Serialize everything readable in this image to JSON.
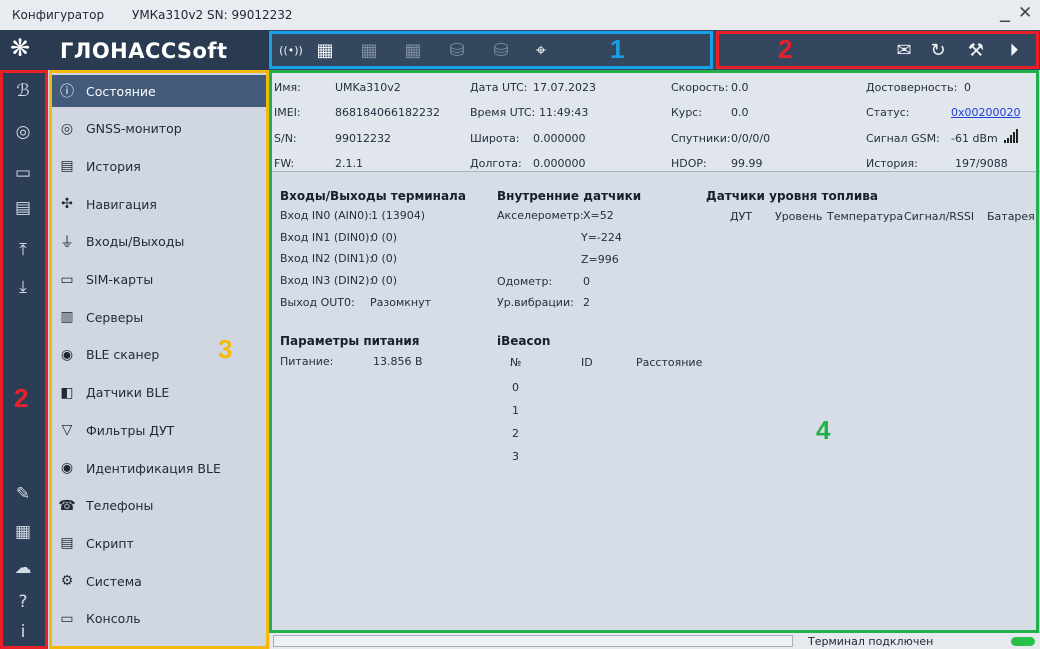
{
  "titlebar": {
    "app": "Конфигуратор",
    "device": "УМКа310v2 SN: 99012232",
    "minimize": "_",
    "close": "✕"
  },
  "logo": {
    "text": "ГЛОНАССSoft",
    "symbol": "❋"
  },
  "toolbar": {
    "icons": [
      {
        "name": "connect-icon",
        "glyph": "((•))",
        "state": "on"
      },
      {
        "name": "terminal-online-icon",
        "glyph": "▦",
        "state": "on"
      },
      {
        "name": "read-config-icon",
        "glyph": "▦",
        "state": "dim"
      },
      {
        "name": "write-config-icon",
        "glyph": "▦",
        "state": "dim"
      },
      {
        "name": "db-settings-icon",
        "glyph": "⛁",
        "state": "dim"
      },
      {
        "name": "db-tools-icon",
        "glyph": "⛁",
        "state": "dim"
      },
      {
        "name": "location-off-icon",
        "glyph": "⌖",
        "state": "on"
      }
    ],
    "right_icons": [
      {
        "name": "send-message-icon",
        "glyph": "✉"
      },
      {
        "name": "reset-icon",
        "glyph": "↻"
      },
      {
        "name": "firmware-update-icon",
        "glyph": "⚒"
      },
      {
        "name": "play-script-icon",
        "glyph": "⏵"
      }
    ]
  },
  "markers": {
    "m1": "1",
    "m2": "2",
    "m2_left": "2",
    "m3": "3",
    "m4": "4"
  },
  "leftbar": {
    "top": [
      {
        "name": "bluetooth-icon",
        "glyph": "ℬ"
      },
      {
        "name": "device-icon",
        "glyph": "◎"
      },
      {
        "name": "open-folder-icon",
        "glyph": "▭"
      },
      {
        "name": "save-icon",
        "glyph": "▤"
      },
      {
        "name": "upload-icon",
        "glyph": "⤒"
      },
      {
        "name": "download-icon",
        "glyph": "⤓"
      }
    ],
    "bottom": [
      {
        "name": "log-icon",
        "glyph": "✎"
      },
      {
        "name": "calculator-icon",
        "glyph": "▦"
      },
      {
        "name": "cloud-icon",
        "glyph": "☁"
      },
      {
        "name": "help-icon",
        "glyph": "?"
      },
      {
        "name": "info-icon",
        "glyph": "i"
      }
    ]
  },
  "menu": [
    {
      "label": "Состояние",
      "icon": "ⓘ",
      "icon_name": "status-icon",
      "active": true
    },
    {
      "label": "GNSS-монитор",
      "icon": "◎",
      "icon_name": "gnss-icon"
    },
    {
      "label": "История",
      "icon": "▤",
      "icon_name": "history-icon"
    },
    {
      "label": "Навигация",
      "icon": "✣",
      "icon_name": "navigation-icon"
    },
    {
      "label": "Входы/Выходы",
      "icon": "⏚",
      "icon_name": "io-icon"
    },
    {
      "label": "SIM-карты",
      "icon": "▭",
      "icon_name": "sim-icon"
    },
    {
      "label": "Серверы",
      "icon": "▥",
      "icon_name": "servers-icon"
    },
    {
      "label": "BLE сканер",
      "icon": "◉",
      "icon_name": "ble-scanner-icon"
    },
    {
      "label": "Датчики BLE",
      "icon": "◧",
      "icon_name": "ble-sensor-icon"
    },
    {
      "label": "Фильтры ДУТ",
      "icon": "▽",
      "icon_name": "fuel-filter-icon"
    },
    {
      "label": "Идентификация BLE",
      "icon": "◉",
      "icon_name": "ble-ident-icon"
    },
    {
      "label": "Телефоны",
      "icon": "☎",
      "icon_name": "phone-icon"
    },
    {
      "label": "Скрипт",
      "icon": "▤",
      "icon_name": "script-icon"
    },
    {
      "label": "Система",
      "icon": "⚙",
      "icon_name": "system-icon"
    },
    {
      "label": "Консоль",
      "icon": "▭",
      "icon_name": "console-icon"
    }
  ],
  "info": {
    "name_l": "Имя:",
    "name_v": "UMKa310v2",
    "imei_l": "IMEI:",
    "imei_v": "868184066182232",
    "sn_l": "S/N:",
    "sn_v": "99012232",
    "fw_l": "FW:",
    "fw_v": "2.1.1",
    "date_l": "Дата UTC:",
    "date_v": "17.07.2023",
    "time_l": "Время UTC:",
    "time_v": "11:49:43",
    "lat_l": "Широта:",
    "lat_v": "0.000000",
    "lon_l": "Долгота:",
    "lon_v": "0.000000",
    "speed_l": "Скорость:",
    "speed_v": "0.0",
    "course_l": "Курс:",
    "course_v": "0.0",
    "sats_l": "Спутники:",
    "sats_v": "0/0/0/0",
    "hdop_l": "HDOP:",
    "hdop_v": "99.99",
    "valid_l": "Достоверность:",
    "valid_v": "0",
    "status_l": "Статус:",
    "status_v": "0x00200020",
    "gsm_l": "Сигнал GSM:",
    "gsm_v": "-61 dBm",
    "hist_l": "История:",
    "hist_v": "197/9088"
  },
  "io": {
    "title": "Входы/Выходы терминала",
    "rows": [
      {
        "l": "Вход IN0 (AIN0):",
        "v": "1 (13904)"
      },
      {
        "l": "Вход IN1 (DIN0):",
        "v": "0 (0)"
      },
      {
        "l": "Вход IN2 (DIN1):",
        "v": "0 (0)"
      },
      {
        "l": "Вход IN3 (DIN2):",
        "v": "0 (0)"
      },
      {
        "l": "Выход OUT0:",
        "v": "Разомкнут"
      }
    ]
  },
  "sensors": {
    "title": "Внутренние датчики",
    "accel_l": "Акселерометр:",
    "ax": "X=52",
    "ay": "Y=-224",
    "az": "Z=996",
    "odo_l": "Одометр:",
    "odo_v": "0",
    "vib_l": "Ур.вибрации:",
    "vib_v": "2"
  },
  "fuel": {
    "title": "Датчики уровня топлива",
    "cols": [
      "ДУТ",
      "Уровень",
      "Температура",
      "Сигнал/RSSI",
      "Батарея"
    ]
  },
  "power": {
    "title": "Параметры питания",
    "l": "Питание:",
    "v": "13.856 В"
  },
  "ibeacon": {
    "title": "iBeacon",
    "cols": [
      "№",
      "ID",
      "Расстояние"
    ],
    "rows": [
      "0",
      "1",
      "2",
      "3"
    ]
  },
  "status": {
    "text": "Терминал подключен"
  },
  "colors": {
    "blue": "#1aa0e6",
    "red": "#e8202a",
    "yellow": "#f5b90e",
    "green": "#21b04a"
  }
}
